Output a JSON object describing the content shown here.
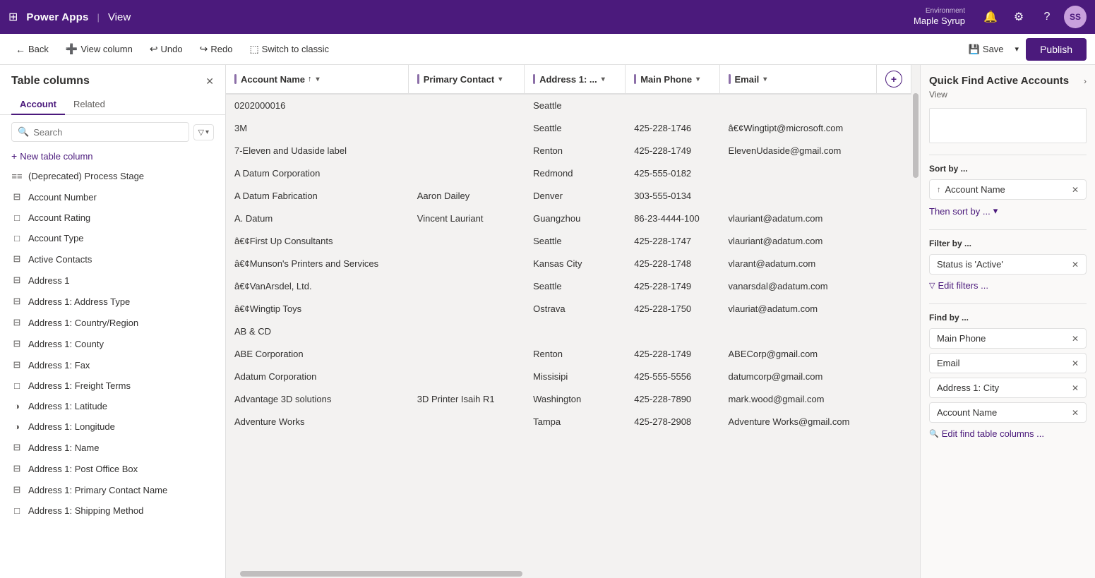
{
  "topNav": {
    "appTitle": "Power Apps",
    "separator": "|",
    "viewLabel": "View",
    "environment": {
      "label": "Environment",
      "name": "Maple Syrup"
    },
    "avatar": "SS"
  },
  "commandBar": {
    "back": "Back",
    "viewColumn": "View column",
    "undo": "Undo",
    "redo": "Redo",
    "switchToClassic": "Switch to classic",
    "save": "Save",
    "publish": "Publish"
  },
  "leftPanel": {
    "title": "Table columns",
    "tabs": [
      "Account",
      "Related"
    ],
    "searchPlaceholder": "Search",
    "newColumnLabel": "New table column",
    "columns": [
      {
        "icon": "≡≡",
        "label": "(Deprecated) Process Stage"
      },
      {
        "icon": "⊟",
        "label": "Account Number"
      },
      {
        "icon": "□",
        "label": "Account Rating"
      },
      {
        "icon": "□",
        "label": "Account Type"
      },
      {
        "icon": "⊟",
        "label": "Active Contacts"
      },
      {
        "icon": "⊟",
        "label": "Address 1"
      },
      {
        "icon": "⊟",
        "label": "Address 1: Address Type"
      },
      {
        "icon": "⊟",
        "label": "Address 1: Country/Region"
      },
      {
        "icon": "⊟",
        "label": "Address 1: County"
      },
      {
        "icon": "⊟",
        "label": "Address 1: Fax"
      },
      {
        "icon": "□",
        "label": "Address 1: Freight Terms"
      },
      {
        "icon": "◑",
        "label": "Address 1: Latitude"
      },
      {
        "icon": "◑",
        "label": "Address 1: Longitude"
      },
      {
        "icon": "⊟",
        "label": "Address 1: Name"
      },
      {
        "icon": "⊟",
        "label": "Address 1: Post Office Box"
      },
      {
        "icon": "⊟",
        "label": "Address 1: Primary Contact Name"
      },
      {
        "icon": "□",
        "label": "Address 1: Shipping Method"
      }
    ]
  },
  "table": {
    "columns": [
      {
        "label": "Account Name",
        "sortIcon": "↑"
      },
      {
        "label": "Primary Contact"
      },
      {
        "label": "Address 1: ..."
      },
      {
        "label": "Main Phone"
      },
      {
        "label": "Email"
      }
    ],
    "rows": [
      {
        "accountName": "0202000016",
        "primaryContact": "",
        "address": "Seattle",
        "mainPhone": "",
        "email": ""
      },
      {
        "accountName": "3M",
        "primaryContact": "",
        "address": "Seattle",
        "mainPhone": "425-228-1746",
        "email": "â€¢Wingtipt@microsoft.com"
      },
      {
        "accountName": "7-Eleven and Udaside label",
        "primaryContact": "",
        "address": "Renton",
        "mainPhone": "425-228-1749",
        "email": "ElevenUdaside@gmail.com"
      },
      {
        "accountName": "A Datum Corporation",
        "primaryContact": "",
        "address": "Redmond",
        "mainPhone": "425-555-0182",
        "email": ""
      },
      {
        "accountName": "A Datum Fabrication",
        "primaryContact": "Aaron Dailey",
        "address": "Denver",
        "mainPhone": "303-555-0134",
        "email": ""
      },
      {
        "accountName": "A. Datum",
        "primaryContact": "Vincent Lauriant",
        "address": "Guangzhou",
        "mainPhone": "86-23-4444-100",
        "email": "vlauriant@adatum.com"
      },
      {
        "accountName": "â€¢First Up Consultants",
        "primaryContact": "",
        "address": "Seattle",
        "mainPhone": "425-228-1747",
        "email": "vlauriant@adatum.com"
      },
      {
        "accountName": "â€¢Munson's Printers and Services",
        "primaryContact": "",
        "address": "Kansas City",
        "mainPhone": "425-228-1748",
        "email": "vlarant@adatum.com"
      },
      {
        "accountName": "â€¢VanArsdel, Ltd.",
        "primaryContact": "",
        "address": "Seattle",
        "mainPhone": "425-228-1749",
        "email": "vanarsdal@adatum.com"
      },
      {
        "accountName": "â€¢Wingtip Toys",
        "primaryContact": "",
        "address": "Ostrava",
        "mainPhone": "425-228-1750",
        "email": "vlauriat@adatum.com"
      },
      {
        "accountName": "AB & CD",
        "primaryContact": "",
        "address": "",
        "mainPhone": "",
        "email": ""
      },
      {
        "accountName": "ABE Corporation",
        "primaryContact": "",
        "address": "Renton",
        "mainPhone": "425-228-1749",
        "email": "ABECorp@gmail.com"
      },
      {
        "accountName": "Adatum Corporation",
        "primaryContact": "",
        "address": "Missisipi",
        "mainPhone": "425-555-5556",
        "email": "datumcorp@gmail.com"
      },
      {
        "accountName": "Advantage 3D solutions",
        "primaryContact": "3D Printer Isaih R1",
        "address": "Washington",
        "mainPhone": "425-228-7890",
        "email": "mark.wood@gmail.com"
      },
      {
        "accountName": "Adventure Works",
        "primaryContact": "",
        "address": "Tampa",
        "mainPhone": "425-278-2908",
        "email": "Adventure Works@gmail.com"
      }
    ]
  },
  "rightPanel": {
    "title": "Quick Find Active Accounts",
    "subtitle": "View",
    "sortBy": {
      "label": "Sort by ...",
      "chip": "Account Name",
      "thenSortLabel": "Then sort by ..."
    },
    "filterBy": {
      "label": "Filter by ...",
      "chip": "Status is 'Active'",
      "editLabel": "Edit filters ..."
    },
    "findBy": {
      "label": "Find by ...",
      "chips": [
        "Main Phone",
        "Email",
        "Address 1: City",
        "Account Name"
      ],
      "editLabel": "Edit find table columns ..."
    }
  }
}
